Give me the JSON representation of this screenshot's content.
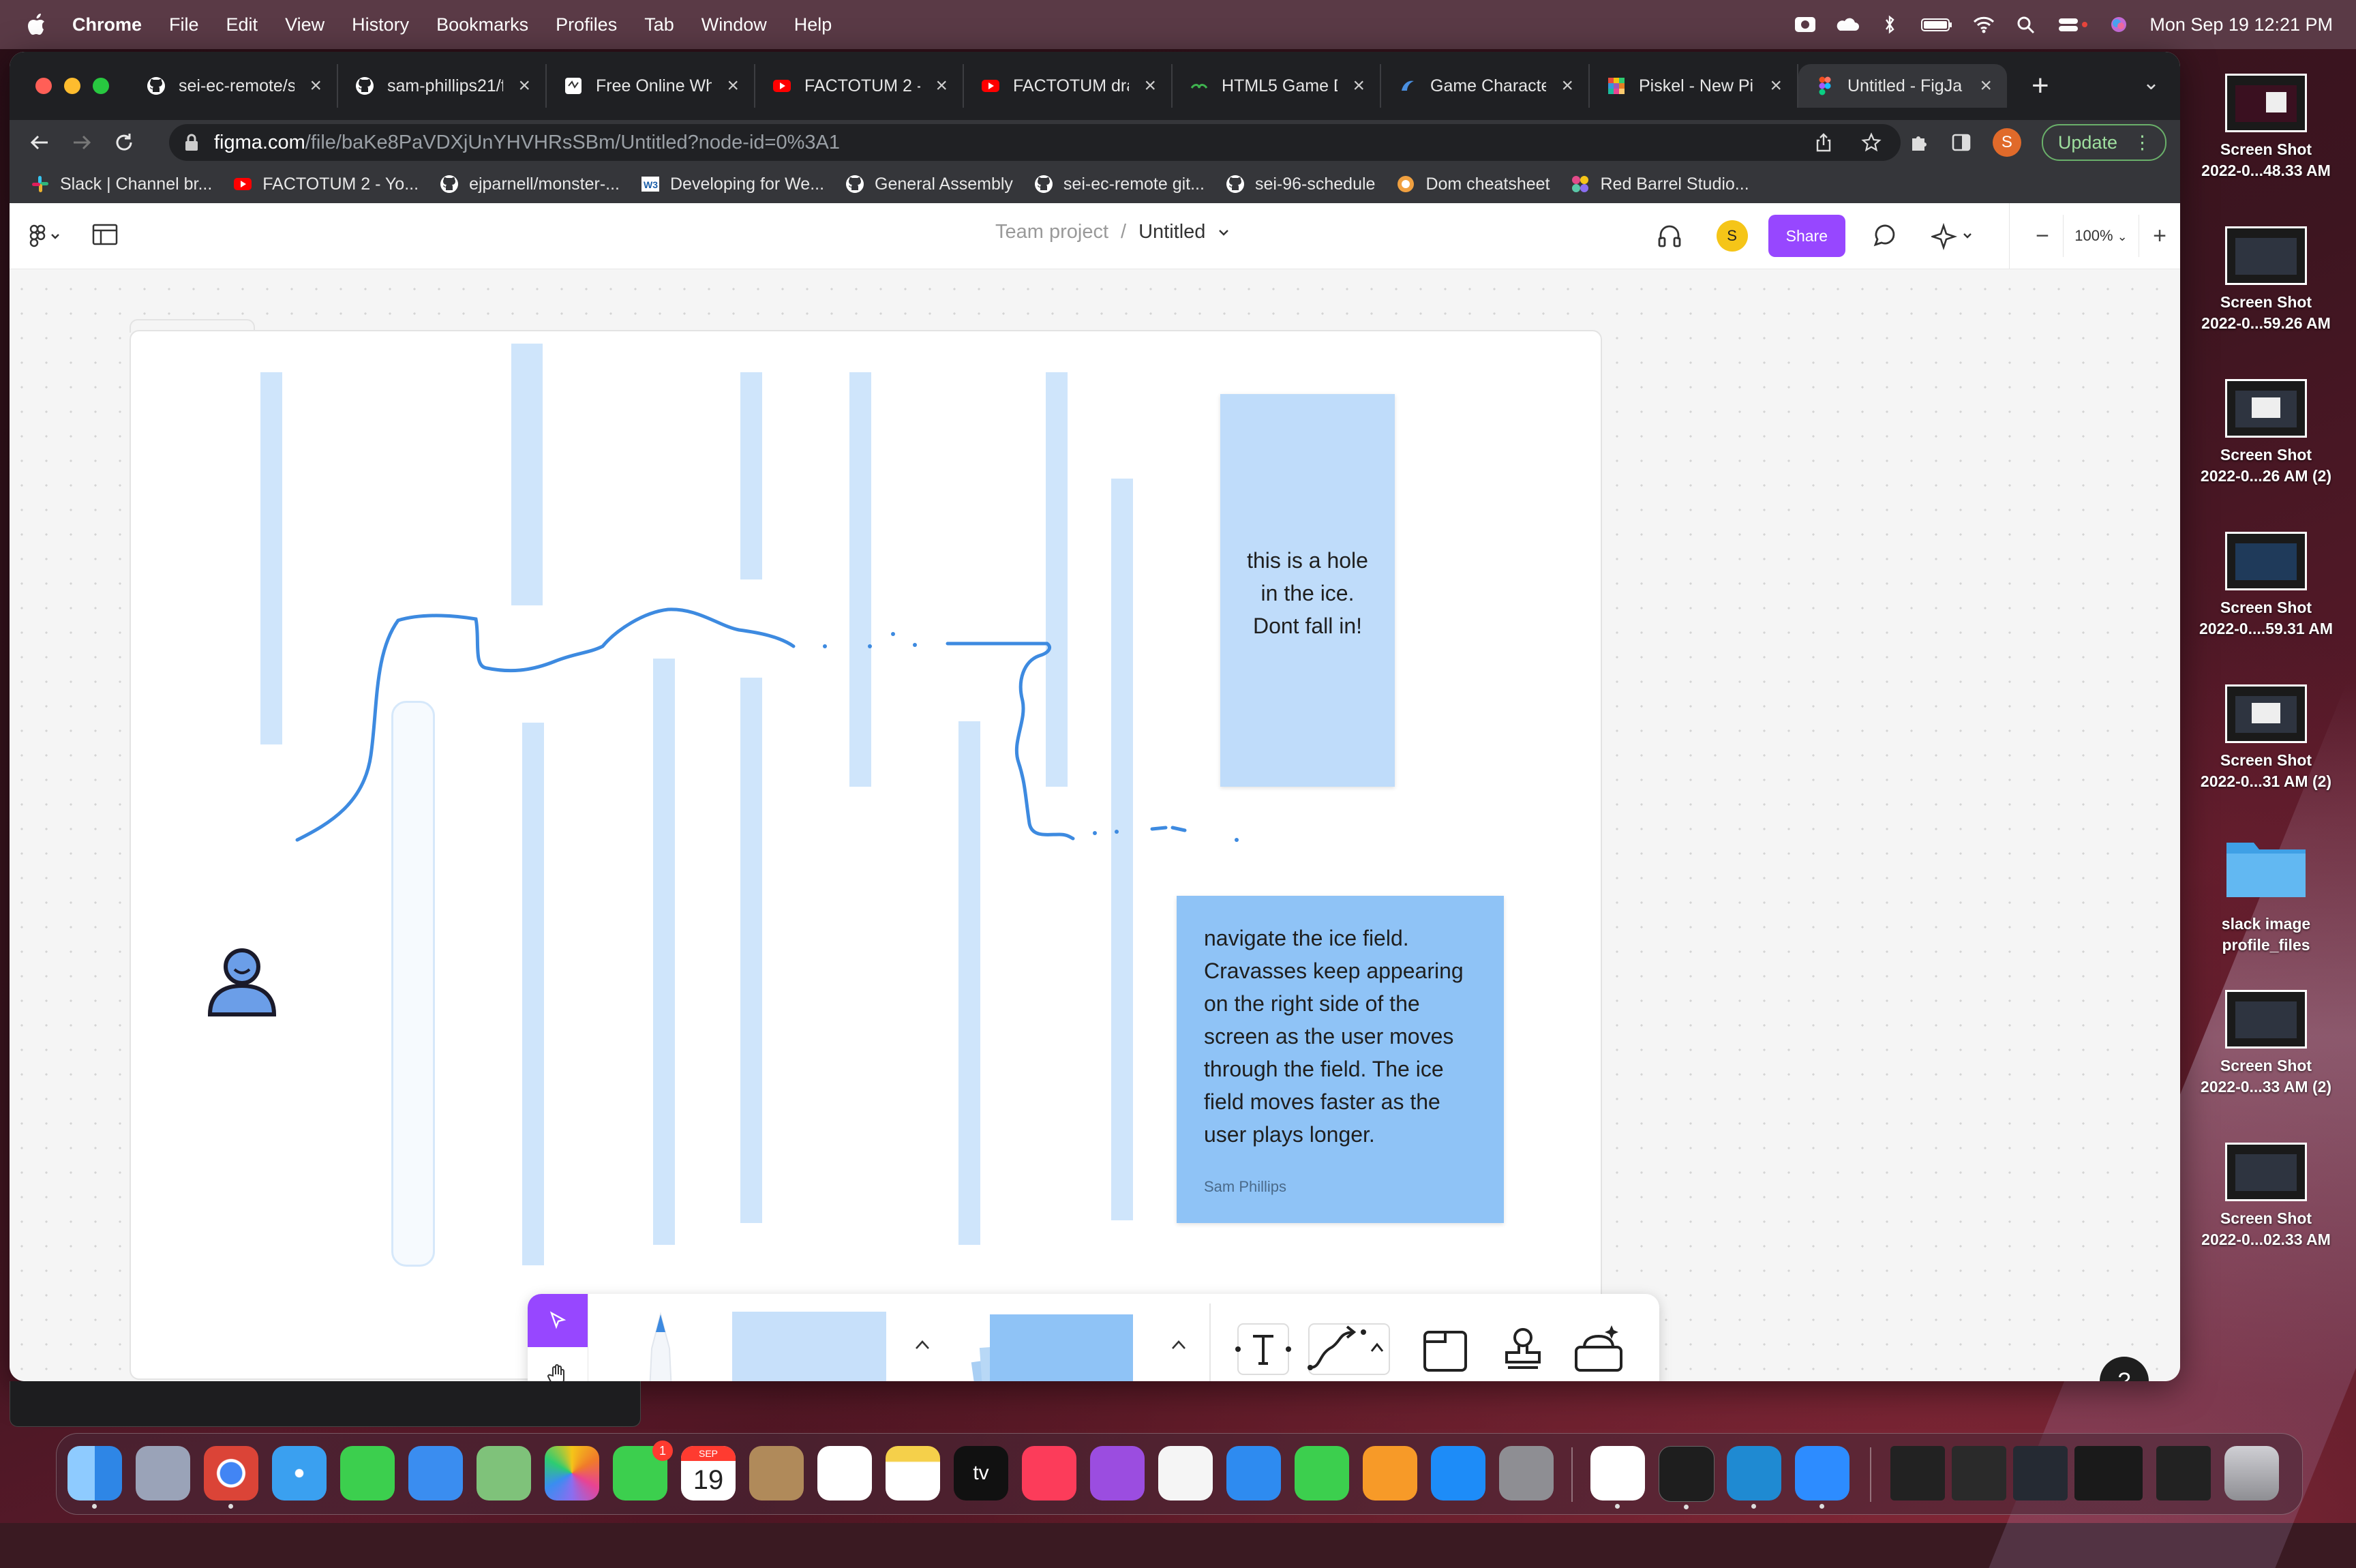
{
  "menubar": {
    "app": "Chrome",
    "items": [
      "File",
      "Edit",
      "View",
      "History",
      "Bookmarks",
      "Profiles",
      "Tab",
      "Window",
      "Help"
    ],
    "clock": "Mon Sep 19  12:21 PM"
  },
  "tabs": [
    {
      "label": "sei-ec-remote/s",
      "icon": "github-icon"
    },
    {
      "label": "sam-phillips21/f",
      "icon": "github-icon"
    },
    {
      "label": "Free Online Wh",
      "icon": "whiteboard-icon"
    },
    {
      "label": "FACTOTUM 2 -",
      "icon": "youtube-icon"
    },
    {
      "label": "FACTOTUM dra",
      "icon": "youtube-icon"
    },
    {
      "label": "HTML5 Game D",
      "icon": "gamedev-icon"
    },
    {
      "label": "Game Characte",
      "icon": "game-icon"
    },
    {
      "label": "Piskel - New Pi",
      "icon": "piskel-icon"
    },
    {
      "label": "Untitled - FigJa",
      "icon": "figma-icon",
      "active": true
    }
  ],
  "address": {
    "host": "figma.com",
    "path": "/file/baKe8PaVDXjUnYHVHRsSBm/Untitled?node-id=0%3A1"
  },
  "toolbar": {
    "profile_initial": "S",
    "update_label": "Update"
  },
  "bookmarks": [
    {
      "label": "Slack | Channel br...",
      "icon": "slack-icon"
    },
    {
      "label": "FACTOTUM 2 - Yo...",
      "icon": "youtube-icon"
    },
    {
      "label": "ejparnell/monster-...",
      "icon": "github-icon"
    },
    {
      "label": "Developing for We...",
      "icon": "w3-icon"
    },
    {
      "label": "General Assembly",
      "icon": "github-icon"
    },
    {
      "label": "sei-ec-remote git...",
      "icon": "github-icon"
    },
    {
      "label": "sei-96-schedule",
      "icon": "github-icon"
    },
    {
      "label": "Dom cheatsheet",
      "icon": "dom-icon"
    },
    {
      "label": "Red Barrel Studio...",
      "icon": "redbarrel-icon"
    }
  ],
  "figjam": {
    "breadcrumb_team": "Team project",
    "breadcrumb_sep": "/",
    "file_name": "Untitled",
    "avatar_initial": "S",
    "share_label": "Share",
    "zoom": "100%",
    "zoom_minus": "−",
    "zoom_plus": "+"
  },
  "stickies": [
    {
      "id": "hole",
      "text": "this is a hole\nin the ice.\nDont fall in!"
    },
    {
      "id": "desc",
      "text": "navigate the ice field. Cravasses keep appearing on the right side of the screen as the user moves through the field. The ice field moves faster as the user plays longer.",
      "author": "Sam Phillips"
    }
  ],
  "help_label": "?",
  "desktop_icons": [
    {
      "line1": "Screen Shot",
      "line2": "2022-0...48.33 AM"
    },
    {
      "line1": "Screen Shot",
      "line2": "2022-0...59.26 AM"
    },
    {
      "line1": "Screen Shot",
      "line2": "2022-0...26 AM (2)"
    },
    {
      "line1": "Screen Shot",
      "line2": "2022-0....59.31 AM"
    },
    {
      "line1": "Screen Shot",
      "line2": "2022-0...31 AM (2)"
    },
    {
      "line1": "slack image",
      "line2": "profile_files"
    },
    {
      "line1": "Screen Shot",
      "line2": "2022-0...33 AM (2)"
    },
    {
      "line1": "Screen Shot",
      "line2": "2022-0...02.33 AM"
    }
  ],
  "dock": {
    "calendar_month": "SEP",
    "calendar_day": "19",
    "facetime_badge": "1",
    "tv_label": "tv"
  },
  "colors": {
    "accent": "#9747ff",
    "sticky_light": "#bfdcfa",
    "sticky_dark": "#8fc3f6",
    "crevasse": "#cfe5fb",
    "path": "#3d8ae0"
  }
}
